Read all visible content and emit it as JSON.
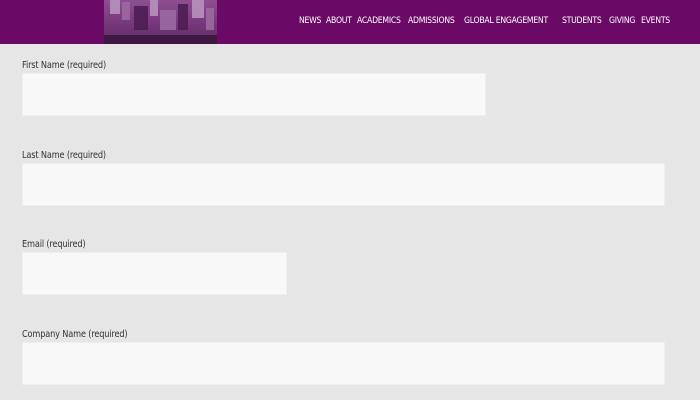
{
  "header": {
    "nav": [
      "NEWS",
      "ABOUT",
      "ACADEMICS",
      "ADMISSIONS",
      "GLOBAL ENGAGEMENT",
      "STUDENTS",
      "GIVING",
      "EVENTS"
    ]
  },
  "form": {
    "first_name_label": "First Name (required)",
    "last_name_label": "Last Name (required)",
    "email_label": "Email (required)",
    "company_label": "Company Name (required)",
    "first_name_value": "",
    "last_name_value": "",
    "email_value": "",
    "company_value": ""
  },
  "colors": {
    "header_bg": "#6a0a66",
    "page_bg": "#e6e6e6",
    "input_bg": "#f8f8f8"
  }
}
